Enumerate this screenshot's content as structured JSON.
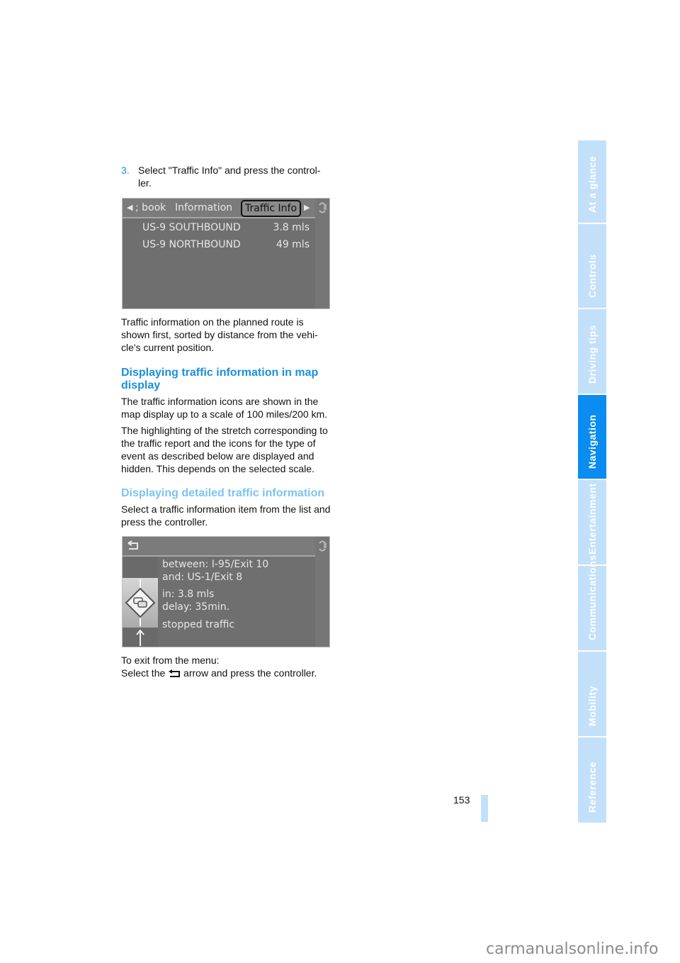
{
  "step3": {
    "number": "3.",
    "text": "Select \"Traffic Info\" and press the control-ler."
  },
  "screen1": {
    "tabs": [
      {
        "label": "; book",
        "selected": false
      },
      {
        "label": "Information",
        "selected": false
      },
      {
        "label": "Traffic Info",
        "selected": true
      }
    ],
    "rows": [
      {
        "road": "US-9 SOUTHBOUND",
        "distance": "3.8 mls"
      },
      {
        "road": "US-9 NORTHBOUND",
        "distance": "49 mls"
      }
    ],
    "colors": {
      "background": "#6f6f6f",
      "text": "#e6e6e6"
    }
  },
  "para1": "Traffic information on the planned route is shown first, sorted by distance from the vehi-cle's current position.",
  "heading1": "Displaying traffic information in map display",
  "para2": "The traffic information icons are shown in the map display up to a scale of 100 miles/200 km.",
  "para3": "The highlighting of the stretch corresponding to the traffic report and the icons for the type of event as described below are displayed and hidden. This depends on the selected scale.",
  "heading2": "Displaying detailed traffic information",
  "para4": "Select a traffic information item from the list and press the controller.",
  "screen2": {
    "back_icon": "return-arrow-icon",
    "event_icon": "traffic-jam-sign-icon",
    "lines": [
      "between: I-95/Exit 10",
      "and: US-1/Exit 8",
      "in: 3.8 mls",
      "delay: 35min.",
      "stopped traffic"
    ]
  },
  "exit": {
    "line1": "To exit from the menu:",
    "line2_pre": "Select the",
    "line2_post": "arrow and press the controller."
  },
  "side_tabs": [
    {
      "label": "At a glance",
      "active": false
    },
    {
      "label": "Controls",
      "active": false
    },
    {
      "label": "Driving tips",
      "active": false
    },
    {
      "label": "Navigation",
      "active": true
    },
    {
      "label": "Entertainment",
      "active": false
    },
    {
      "label": "Communications",
      "active": false
    },
    {
      "label": "Mobility",
      "active": false
    },
    {
      "label": "Reference",
      "active": false
    }
  ],
  "page_number": "153",
  "watermark": "carmanualsonline.info",
  "colors": {
    "accent": "#1a8fe0",
    "heading_light": "#7cc3f3",
    "tab_inactive": "#c2e0fa",
    "tab_active": "#0a8cf0"
  }
}
